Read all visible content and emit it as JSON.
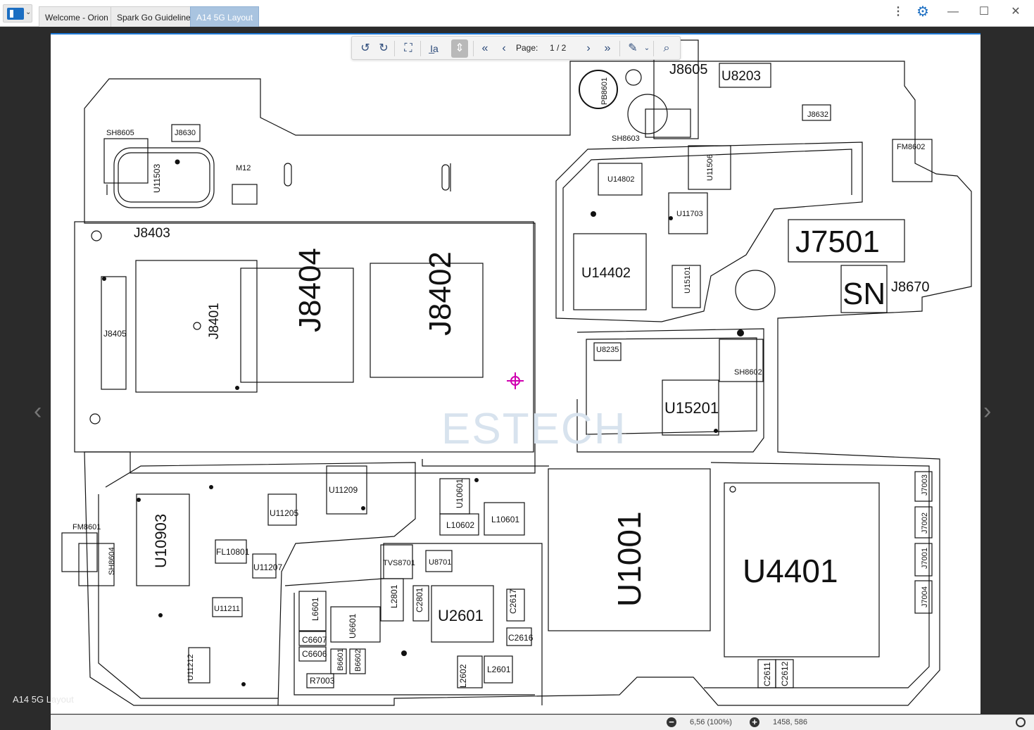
{
  "window": {
    "tabs": [
      {
        "label": "Welcome - Orion"
      },
      {
        "label": "Spark Go Guideline"
      },
      {
        "label": "A14 5G Layout"
      }
    ],
    "active_tab": "A14 5G Layout",
    "controls": {
      "more": "⋮",
      "settings": "⚙",
      "minimize": "—",
      "maximize": "☐",
      "close": "✕"
    }
  },
  "toolbar": {
    "page_label": "Page:",
    "page_value": "1 / 2"
  },
  "document": {
    "label": "A14 5G Layout",
    "components": {
      "large": [
        "J8403",
        "J8404",
        "J8402",
        "J8401",
        "J8405",
        "U14402",
        "U14802",
        "U11703",
        "U15101",
        "U11506",
        "J7501",
        "SN",
        "J8670",
        "U15201",
        "U1001",
        "U4401",
        "U10903",
        "U11209",
        "U11205",
        "FL10801",
        "U11207",
        "U11211",
        "U11212",
        "U2601",
        "L2601",
        "L2602",
        "L6601",
        "U6601",
        "C6607",
        "C6606",
        "R7003",
        "B6601",
        "B6602",
        "TVS8701",
        "U8701",
        "L2801",
        "C2801",
        "C2617",
        "C2616",
        "U10601",
        "L10602",
        "L10601",
        "U8235",
        "C2611",
        "C2612"
      ],
      "labels": [
        "SH8605",
        "J8630",
        "U11503",
        "M12",
        "PB8601",
        "J8605",
        "U8203",
        "J8632",
        "SH8603",
        "FM8602",
        "SH8602",
        "FM8601",
        "SH8604",
        "J7003",
        "J7002",
        "J7001",
        "J7004",
        "ESTECH"
      ]
    }
  },
  "status": {
    "zoom": "6,56 (100%)",
    "coordinates": "1458, 586"
  }
}
